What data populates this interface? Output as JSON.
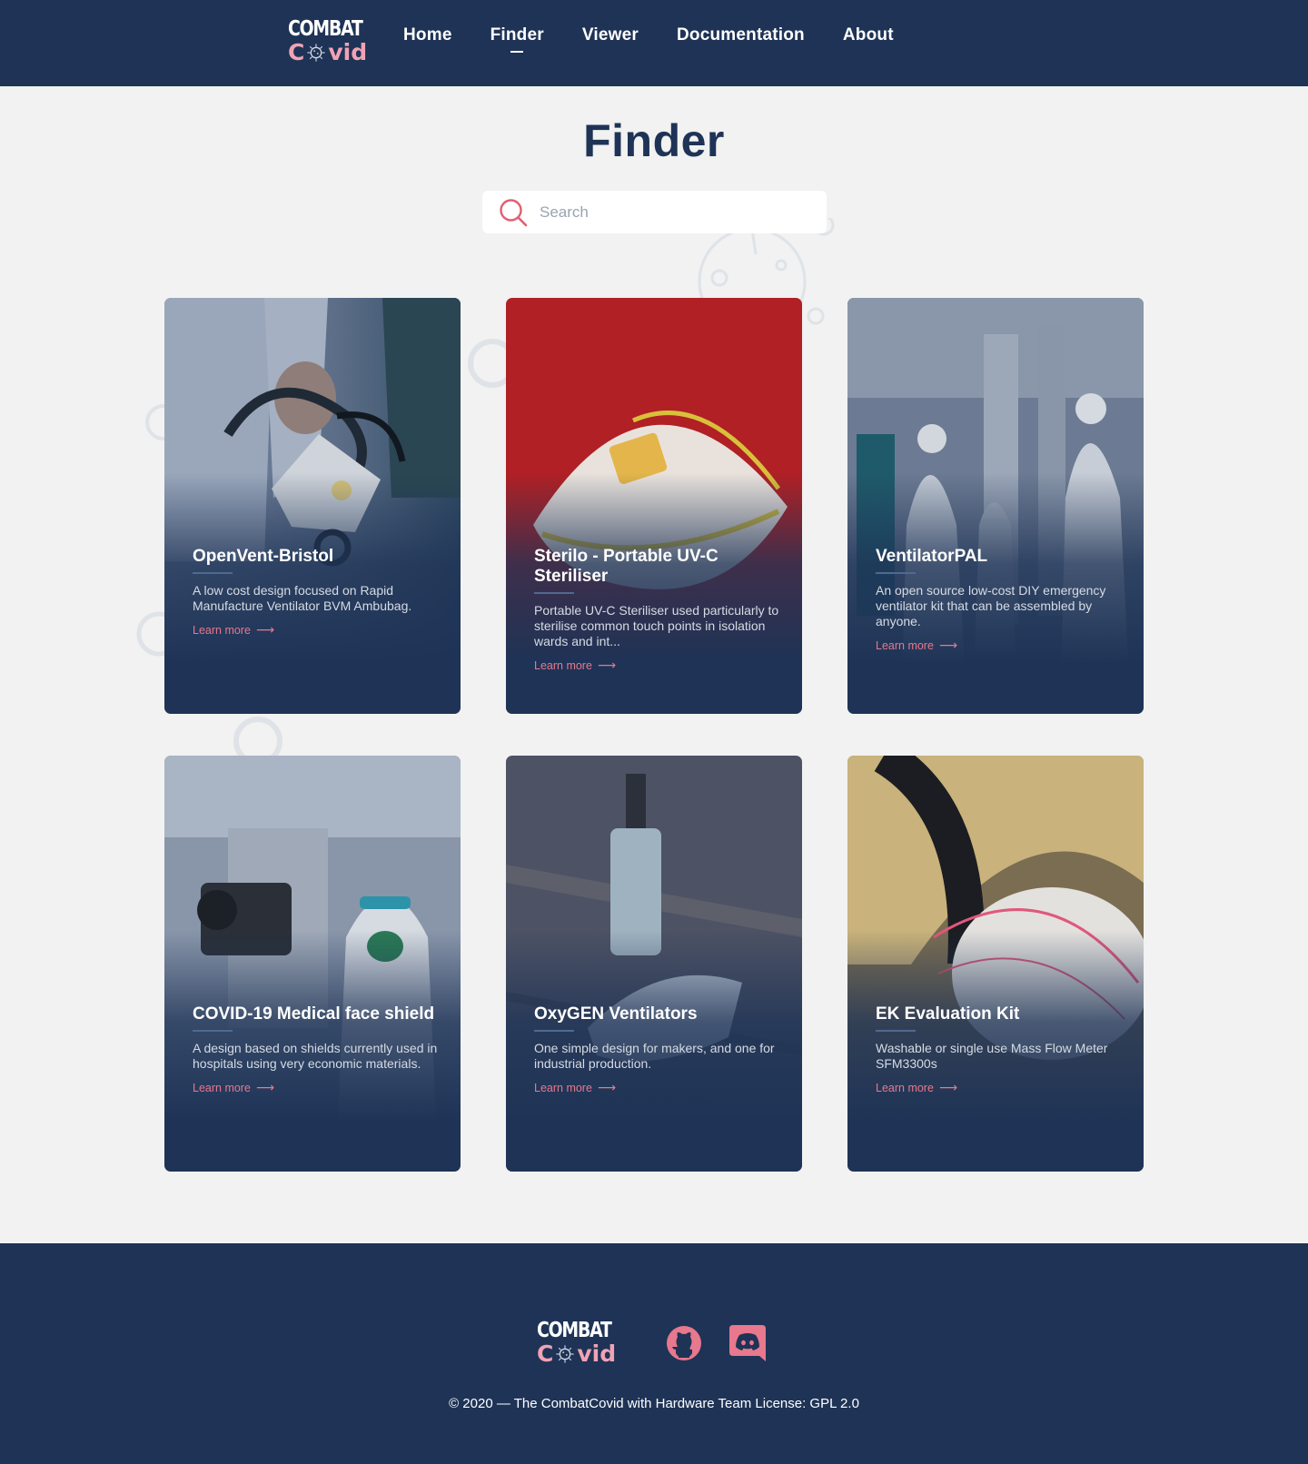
{
  "brand": {
    "line1": "COMBAT",
    "line2_start": "C",
    "line2_end": "vid",
    "accent_color": "#f0a3b4",
    "primary_color": "#1e3356"
  },
  "nav": {
    "items": [
      {
        "label": "Home",
        "active": false
      },
      {
        "label": "Finder",
        "active": true
      },
      {
        "label": "Viewer",
        "active": false
      },
      {
        "label": "Documentation",
        "active": false
      },
      {
        "label": "About",
        "active": false
      }
    ]
  },
  "page": {
    "title": "Finder"
  },
  "search": {
    "placeholder": "Search",
    "value": "",
    "icon": "search-icon"
  },
  "cards": [
    {
      "title": "OpenVent-Bristol",
      "description": "A low cost design focused on Rapid Manufacture Ventilator BVM Ambubag.",
      "link_label": "Learn more"
    },
    {
      "title": "Sterilo - Portable UV-C Steriliser",
      "description": "Portable UV-C Steriliser used particularly to sterilise common touch points in isolation wards and int...",
      "link_label": "Learn more"
    },
    {
      "title": "VentilatorPAL",
      "description": "An open source low-cost DIY emergency ventilator kit that can be assembled by anyone.",
      "link_label": "Learn more"
    },
    {
      "title": "COVID-19 Medical face shield",
      "description": "A design based on shields currently used in hospitals using very economic materials.",
      "link_label": "Learn more"
    },
    {
      "title": "OxyGEN Ventilators",
      "description": "One simple design for makers, and one for industrial production.",
      "link_label": "Learn more"
    },
    {
      "title": "EK Evaluation Kit",
      "description": "Washable or single use Mass Flow Meter SFM3300s",
      "link_label": "Learn more"
    }
  ],
  "footer": {
    "social": [
      {
        "icon": "github-icon"
      },
      {
        "icon": "discord-icon"
      }
    ],
    "copyright": "© 2020 — The CombatCovid with Hardware Team License: GPL 2.0",
    "icon_color": "#e7788d"
  }
}
